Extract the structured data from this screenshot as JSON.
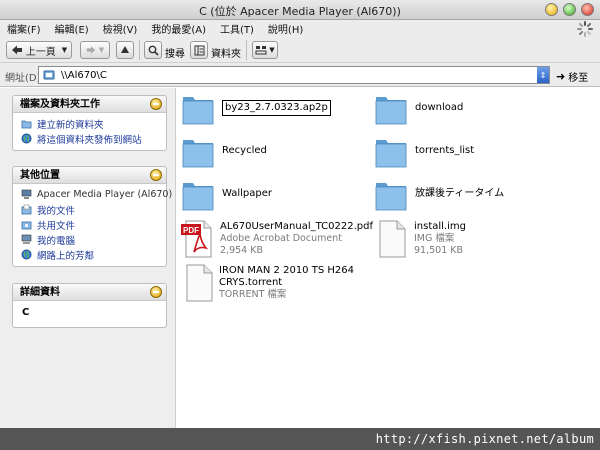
{
  "window": {
    "title": "C (位於 Apacer Media Player (Al670))"
  },
  "menu": [
    {
      "label": "檔案(F)"
    },
    {
      "label": "編輯(E)"
    },
    {
      "label": "檢視(V)"
    },
    {
      "label": "我的最愛(A)"
    },
    {
      "label": "工具(T)"
    },
    {
      "label": "說明(H)"
    }
  ],
  "toolbar": {
    "back_label": "上一頁",
    "search_label": "搜尋",
    "folders_label": "資料夾"
  },
  "address": {
    "label": "網址(D)",
    "value": "\\\\Al670\\C",
    "go_label": "移至"
  },
  "tasks_panel": {
    "title": "檔案及資料夾工作",
    "items": [
      {
        "label": "建立新的資料夾"
      },
      {
        "label": "將這個資料夾發佈到網站"
      }
    ]
  },
  "places_panel": {
    "title": "其他位置",
    "items": [
      {
        "label": "Apacer Media Player (Al670)"
      },
      {
        "label": "我的文件"
      },
      {
        "label": "共用文件"
      },
      {
        "label": "我的電腦"
      },
      {
        "label": "網路上的芳鄰"
      }
    ]
  },
  "details_panel": {
    "title": "詳細資料",
    "value": "C"
  },
  "files": {
    "folders": [
      {
        "name": "by23_2.7.0323.ap2p"
      },
      {
        "name": "download"
      },
      {
        "name": "Recycled"
      },
      {
        "name": "torrents_list"
      },
      {
        "name": "Wallpaper"
      },
      {
        "name": "放課後ティータイム"
      }
    ],
    "docs": [
      {
        "name": "AL670UserManual_TC0222.pdf",
        "type": "Adobe Acrobat Document",
        "size": "2,954 KB",
        "icon_label": "PDF"
      },
      {
        "name": "install.img",
        "type": "IMG 檔案",
        "size": "91,501 KB"
      },
      {
        "name_line1": "IRON MAN 2 2010 TS H264",
        "name_line2": "CRYS.torrent",
        "type": "TORRENT 檔案"
      }
    ]
  },
  "watermark": "http://xfish.pixnet.net/album",
  "colors": {
    "link": "#1d3a9a",
    "folder": "#6aa6d6",
    "accent": "#2a62c8"
  }
}
